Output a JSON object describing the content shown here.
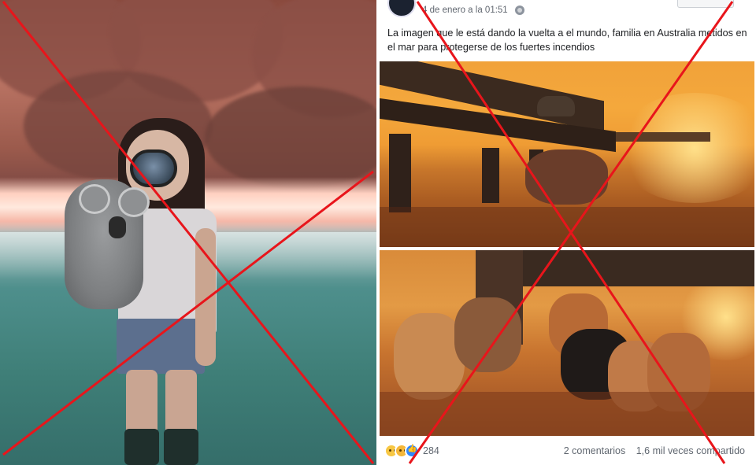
{
  "post": {
    "timestamp": "4 de enero a la 01:51",
    "text": "La imagen que le está dando la vuelta a el mundo, familia en Australia metidos en el mar para protegerse de los fuertes incendios",
    "reaction_count": "284",
    "comments": "2 comentarios",
    "shares": "1,6 mil veces compartido"
  },
  "icons": {
    "privacy": "globe-icon",
    "reactions": [
      "sad-reaction-icon",
      "wow-reaction-icon",
      "like-reaction-icon"
    ]
  },
  "colors": {
    "cross_red": "#e8151b",
    "facebook_text": "#1c1e21",
    "facebook_meta": "#606770",
    "like_blue": "#2d88ff"
  }
}
